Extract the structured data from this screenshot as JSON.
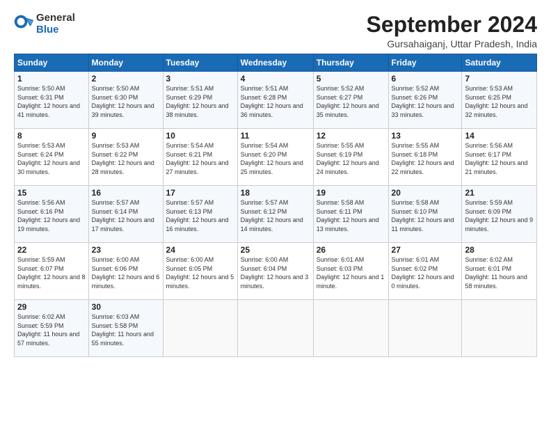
{
  "logo": {
    "general": "General",
    "blue": "Blue"
  },
  "title": "September 2024",
  "location": "Gursahaiganj, Uttar Pradesh, India",
  "days_of_week": [
    "Sunday",
    "Monday",
    "Tuesday",
    "Wednesday",
    "Thursday",
    "Friday",
    "Saturday"
  ],
  "weeks": [
    [
      {
        "day": "1",
        "sunrise": "5:50 AM",
        "sunset": "6:31 PM",
        "daylight": "12 hours and 41 minutes."
      },
      {
        "day": "2",
        "sunrise": "5:50 AM",
        "sunset": "6:30 PM",
        "daylight": "12 hours and 39 minutes."
      },
      {
        "day": "3",
        "sunrise": "5:51 AM",
        "sunset": "6:29 PM",
        "daylight": "12 hours and 38 minutes."
      },
      {
        "day": "4",
        "sunrise": "5:51 AM",
        "sunset": "6:28 PM",
        "daylight": "12 hours and 36 minutes."
      },
      {
        "day": "5",
        "sunrise": "5:52 AM",
        "sunset": "6:27 PM",
        "daylight": "12 hours and 35 minutes."
      },
      {
        "day": "6",
        "sunrise": "5:52 AM",
        "sunset": "6:26 PM",
        "daylight": "12 hours and 33 minutes."
      },
      {
        "day": "7",
        "sunrise": "5:53 AM",
        "sunset": "6:25 PM",
        "daylight": "12 hours and 32 minutes."
      }
    ],
    [
      {
        "day": "8",
        "sunrise": "5:53 AM",
        "sunset": "6:24 PM",
        "daylight": "12 hours and 30 minutes."
      },
      {
        "day": "9",
        "sunrise": "5:53 AM",
        "sunset": "6:22 PM",
        "daylight": "12 hours and 28 minutes."
      },
      {
        "day": "10",
        "sunrise": "5:54 AM",
        "sunset": "6:21 PM",
        "daylight": "12 hours and 27 minutes."
      },
      {
        "day": "11",
        "sunrise": "5:54 AM",
        "sunset": "6:20 PM",
        "daylight": "12 hours and 25 minutes."
      },
      {
        "day": "12",
        "sunrise": "5:55 AM",
        "sunset": "6:19 PM",
        "daylight": "12 hours and 24 minutes."
      },
      {
        "day": "13",
        "sunrise": "5:55 AM",
        "sunset": "6:18 PM",
        "daylight": "12 hours and 22 minutes."
      },
      {
        "day": "14",
        "sunrise": "5:56 AM",
        "sunset": "6:17 PM",
        "daylight": "12 hours and 21 minutes."
      }
    ],
    [
      {
        "day": "15",
        "sunrise": "5:56 AM",
        "sunset": "6:16 PM",
        "daylight": "12 hours and 19 minutes."
      },
      {
        "day": "16",
        "sunrise": "5:57 AM",
        "sunset": "6:14 PM",
        "daylight": "12 hours and 17 minutes."
      },
      {
        "day": "17",
        "sunrise": "5:57 AM",
        "sunset": "6:13 PM",
        "daylight": "12 hours and 16 minutes."
      },
      {
        "day": "18",
        "sunrise": "5:57 AM",
        "sunset": "6:12 PM",
        "daylight": "12 hours and 14 minutes."
      },
      {
        "day": "19",
        "sunrise": "5:58 AM",
        "sunset": "6:11 PM",
        "daylight": "12 hours and 13 minutes."
      },
      {
        "day": "20",
        "sunrise": "5:58 AM",
        "sunset": "6:10 PM",
        "daylight": "12 hours and 11 minutes."
      },
      {
        "day": "21",
        "sunrise": "5:59 AM",
        "sunset": "6:09 PM",
        "daylight": "12 hours and 9 minutes."
      }
    ],
    [
      {
        "day": "22",
        "sunrise": "5:59 AM",
        "sunset": "6:07 PM",
        "daylight": "12 hours and 8 minutes."
      },
      {
        "day": "23",
        "sunrise": "6:00 AM",
        "sunset": "6:06 PM",
        "daylight": "12 hours and 6 minutes."
      },
      {
        "day": "24",
        "sunrise": "6:00 AM",
        "sunset": "6:05 PM",
        "daylight": "12 hours and 5 minutes."
      },
      {
        "day": "25",
        "sunrise": "6:00 AM",
        "sunset": "6:04 PM",
        "daylight": "12 hours and 3 minutes."
      },
      {
        "day": "26",
        "sunrise": "6:01 AM",
        "sunset": "6:03 PM",
        "daylight": "12 hours and 1 minute."
      },
      {
        "day": "27",
        "sunrise": "6:01 AM",
        "sunset": "6:02 PM",
        "daylight": "12 hours and 0 minutes."
      },
      {
        "day": "28",
        "sunrise": "6:02 AM",
        "sunset": "6:01 PM",
        "daylight": "11 hours and 58 minutes."
      }
    ],
    [
      {
        "day": "29",
        "sunrise": "6:02 AM",
        "sunset": "5:59 PM",
        "daylight": "11 hours and 57 minutes."
      },
      {
        "day": "30",
        "sunrise": "6:03 AM",
        "sunset": "5:58 PM",
        "daylight": "11 hours and 55 minutes."
      },
      null,
      null,
      null,
      null,
      null
    ]
  ]
}
